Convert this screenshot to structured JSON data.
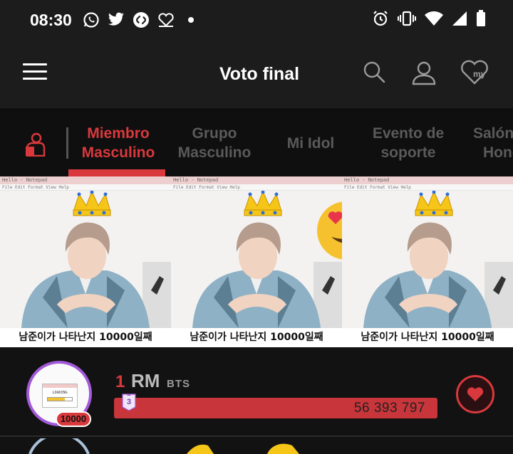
{
  "status_bar": {
    "time": "08:30",
    "left_icons": [
      "whatsapp-icon",
      "twitter-icon",
      "shazam-icon",
      "heart-chat-icon",
      "dot-icon"
    ],
    "right_icons": [
      "alarm-icon",
      "vibrate-icon",
      "wifi-icon",
      "signal-icon",
      "battery-icon"
    ]
  },
  "app_bar": {
    "title": "Voto final",
    "icons": [
      "menu-icon",
      "search-icon",
      "profile-icon",
      "my-heart-icon"
    ],
    "my_label": "my"
  },
  "tabs": [
    {
      "line1": "Miembro",
      "line2": "Masculino",
      "active": true
    },
    {
      "line1": "Grupo",
      "line2": "Masculino",
      "active": false
    },
    {
      "line1": "Mi Idol",
      "line2": "",
      "active": false
    },
    {
      "line1": "Evento de",
      "line2": "soporte",
      "active": false
    },
    {
      "line1": "Salón",
      "line2": "Hono",
      "active": false
    }
  ],
  "banner": {
    "window_title": "Hello - Notepad",
    "menu": "File  Edit  Format  View  Help",
    "caption": "남준이가 나타난지 10000일째"
  },
  "ranking": [
    {
      "rank": "1",
      "name": "RM",
      "group": "BTS",
      "votes": "56 393 797",
      "badge_count": "10000",
      "rank_change": "3",
      "avatar_text": "LOADING"
    }
  ],
  "colors": {
    "accent": "#d9393d",
    "avatar_ring": "#a35ad8",
    "background": "#121212",
    "appbar": "#1c1c1c"
  }
}
